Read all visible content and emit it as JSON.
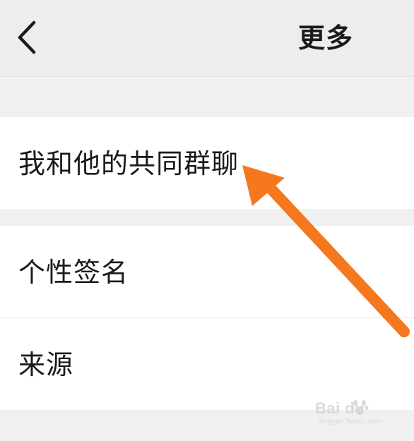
{
  "header": {
    "title": "更多",
    "back_icon": "chevron-left-icon"
  },
  "menu": {
    "items": [
      {
        "label": "我和他的共同群聊"
      },
      {
        "label": "个性签名"
      },
      {
        "label": "来源"
      }
    ]
  },
  "annotation": {
    "arrow_color": "#f5781e"
  },
  "watermark": {
    "logo_text": "Bai du",
    "sub_text": "jingyan.baidu.com"
  }
}
